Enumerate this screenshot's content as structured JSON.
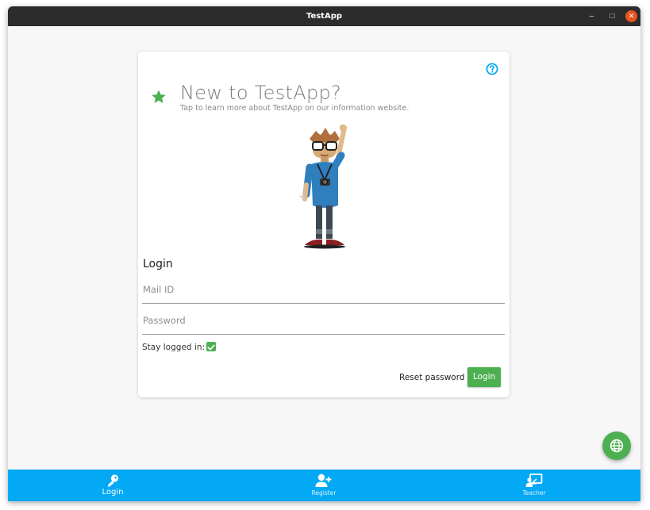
{
  "window": {
    "title": "TestApp",
    "minimize_glyph": "–",
    "maximize_glyph": "□",
    "close_glyph": "✕"
  },
  "promo": {
    "title": "New to TestApp?",
    "subtitle": "Tap to learn more about TestApp on our information website.",
    "icon": "star-icon",
    "accent_color": "#4caf50"
  },
  "help": {
    "icon": "help-circle-icon",
    "color": "#03a9f4"
  },
  "mascot": {
    "icon": "waving-mascot-illustration"
  },
  "login": {
    "heading": "Login",
    "mail_placeholder": "Mail ID",
    "mail_value": "",
    "password_placeholder": "Password",
    "password_value": "",
    "stay_logged_in_label": "Stay logged in:",
    "stay_logged_in_checked": true,
    "reset_label": "Reset password",
    "submit_label": "Login"
  },
  "fab": {
    "icon": "globe-icon",
    "color": "#4caf50"
  },
  "bottom_nav": {
    "color": "#03a9f4",
    "items": [
      {
        "label": "Login",
        "icon": "key-icon",
        "active": true
      },
      {
        "label": "Register",
        "icon": "add-user-icon",
        "active": false
      },
      {
        "label": "Teacher",
        "icon": "presentation-board-icon",
        "active": false
      }
    ]
  }
}
